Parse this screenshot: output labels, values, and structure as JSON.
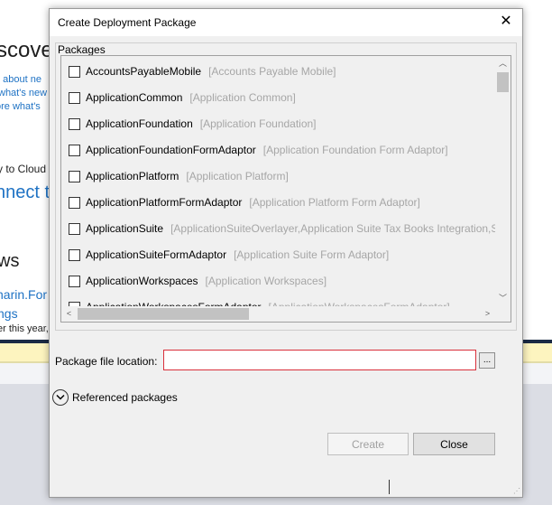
{
  "background": {
    "heading": "scover",
    "links": [
      "n about ne",
      "what's new",
      "ore what's"
    ],
    "cloud_text": "y to Cloud",
    "connect": "nnect to",
    "news_heading": "ws",
    "news_link_1": "narin.For",
    "news_link_2": "ngs",
    "news_snippet": "er this year,"
  },
  "dialog": {
    "title": "Create Deployment Package",
    "close_glyph": "✕",
    "packages_label": "Packages",
    "packages": [
      {
        "name": "AccountsPayableMobile",
        "description": "[Accounts Payable Mobile]",
        "checked": false
      },
      {
        "name": "ApplicationCommon",
        "description": "[Application Common]",
        "checked": false
      },
      {
        "name": "ApplicationFoundation",
        "description": "[Application Foundation]",
        "checked": false
      },
      {
        "name": "ApplicationFoundationFormAdaptor",
        "description": "[Application Foundation Form Adaptor]",
        "checked": false
      },
      {
        "name": "ApplicationPlatform",
        "description": "[Application Platform]",
        "checked": false
      },
      {
        "name": "ApplicationPlatformFormAdaptor",
        "description": "[Application Platform Form Adaptor]",
        "checked": false
      },
      {
        "name": "ApplicationSuite",
        "description": "[ApplicationSuiteOverlayer,Application Suite Tax Books Integration,S",
        "checked": false
      },
      {
        "name": "ApplicationSuiteFormAdaptor",
        "description": "[Application Suite Form Adaptor]",
        "checked": false
      },
      {
        "name": "ApplicationWorkspaces",
        "description": "[Application Workspaces]",
        "checked": false
      },
      {
        "name": "ApplicationWorkspacesFormAdaptor",
        "description": "[ApplicationWorkspacesFormAdaptor]",
        "checked": false
      }
    ],
    "scroll_up_glyph": "︿",
    "scroll_down_glyph": "﹀",
    "scroll_left_glyph": "<",
    "scroll_right_glyph": ">",
    "package_location_label": "Package file location:",
    "package_location_value": "",
    "browse_label": "...",
    "referenced_packages_label": "Referenced packages",
    "create_label": "Create",
    "close_label": "Close",
    "resize_glyph": "⋰"
  }
}
